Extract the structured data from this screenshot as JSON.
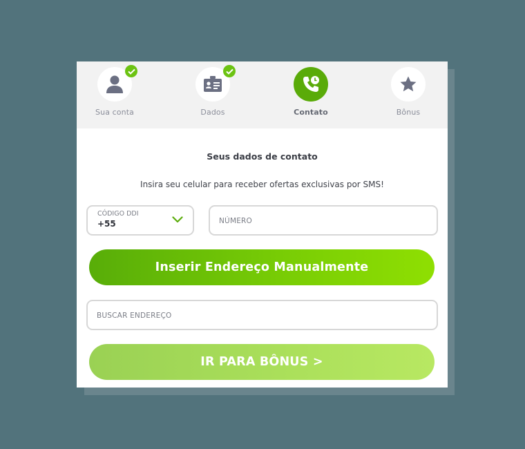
{
  "steps": [
    {
      "label": "Sua conta",
      "icon": "user-icon",
      "completed": true,
      "active": false
    },
    {
      "label": "Dados",
      "icon": "id-card-icon",
      "completed": true,
      "active": false
    },
    {
      "label": "Contato",
      "icon": "phone-icon",
      "completed": false,
      "active": true
    },
    {
      "label": "Bônus",
      "icon": "star-icon",
      "completed": false,
      "active": false
    }
  ],
  "form": {
    "title": "Seus dados de contato",
    "subtitle": "Insira seu celular para receber ofertas exclusivas por SMS!",
    "ddi": {
      "label": "CÓDIGO DDI",
      "value": "+55"
    },
    "numero": {
      "placeholder": "NÚMERO",
      "value": ""
    },
    "manual_button": "Inserir Endereço Manualmente",
    "endereco": {
      "placeholder": "BUSCAR ENDEREÇO",
      "value": ""
    },
    "next_button": "IR PARA BÔNUS >"
  },
  "colors": {
    "background": "#52737c",
    "accent_green": "#5aab09",
    "check_green": "#6cc312",
    "button_disabled": "#aadf5a"
  }
}
